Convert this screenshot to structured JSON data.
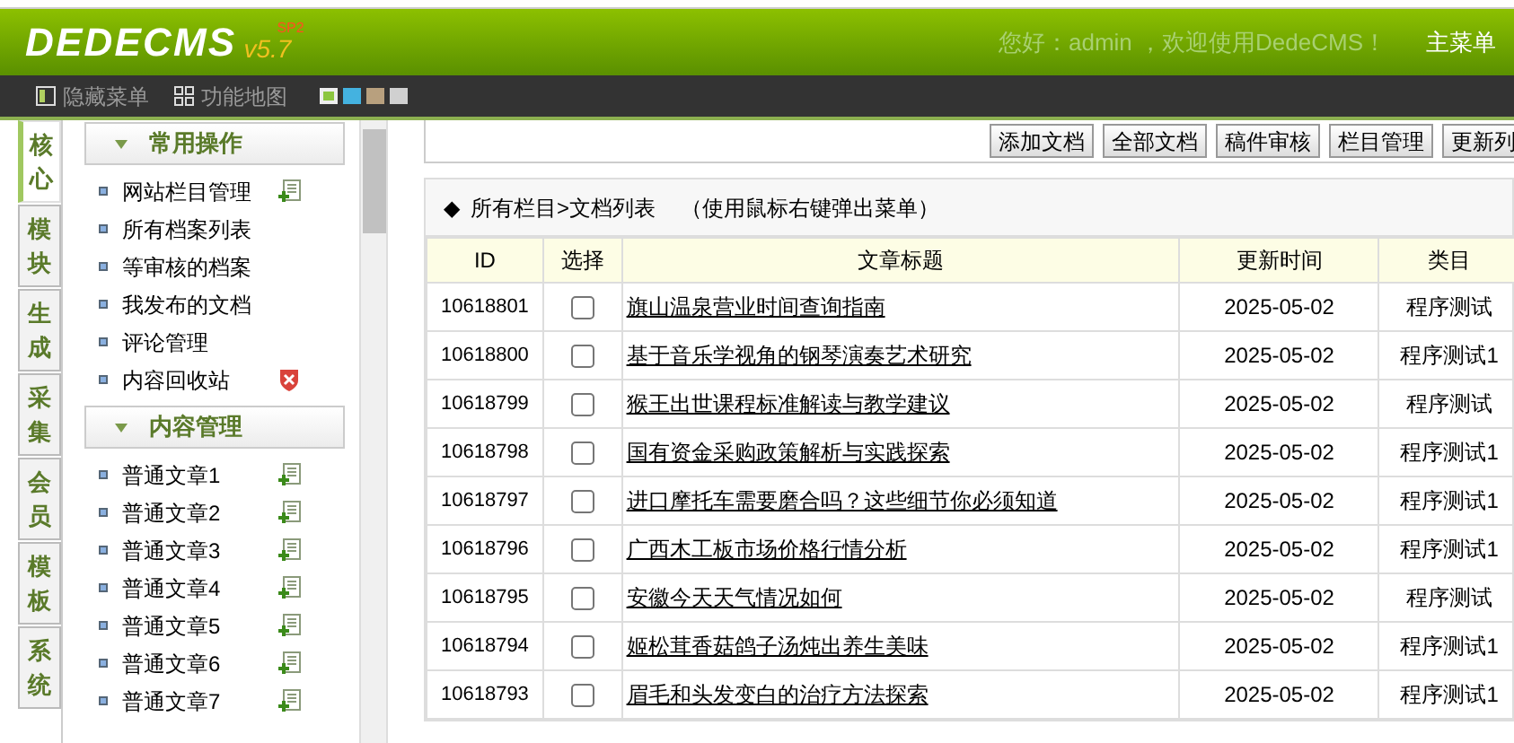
{
  "header": {
    "logo": "DEDECMS",
    "version": "v5.7",
    "edition": "SP2",
    "welcome": "您好：admin ，欢迎使用DedeCMS！",
    "main_menu": "主菜单"
  },
  "toolbar": {
    "items": [
      {
        "label": "隐藏菜单",
        "kind": "layout"
      },
      {
        "label": "功能地图",
        "kind": "grid"
      }
    ],
    "skins": [
      {
        "color": "#8cc63f",
        "selected": true
      },
      {
        "color": "#44b2e0",
        "selected": false
      },
      {
        "color": "#b8a07e",
        "selected": false
      },
      {
        "color": "#d0d0d0",
        "selected": false
      }
    ]
  },
  "side_tabs": [
    {
      "label": "核心",
      "selected": true
    },
    {
      "label": "模块",
      "selected": false
    },
    {
      "label": "生成",
      "selected": false
    },
    {
      "label": "采集",
      "selected": false
    },
    {
      "label": "会员",
      "selected": false
    },
    {
      "label": "模板",
      "selected": false
    },
    {
      "label": "系统",
      "selected": false
    }
  ],
  "menu_groups": [
    {
      "title": "常用操作",
      "items": [
        {
          "label": "网站栏目管理",
          "kind": "add"
        },
        {
          "label": "所有档案列表",
          "kind": "plain"
        },
        {
          "label": "等审核的档案",
          "kind": "plain"
        },
        {
          "label": "我发布的文档",
          "kind": "plain"
        },
        {
          "label": "评论管理",
          "kind": "plain"
        },
        {
          "label": "内容回收站",
          "kind": "delete"
        }
      ]
    },
    {
      "title": "内容管理",
      "items": [
        {
          "label": "普通文章1",
          "kind": "add"
        },
        {
          "label": "普通文章2",
          "kind": "add"
        },
        {
          "label": "普通文章3",
          "kind": "add"
        },
        {
          "label": "普通文章4",
          "kind": "add"
        },
        {
          "label": "普通文章5",
          "kind": "add"
        },
        {
          "label": "普通文章6",
          "kind": "add"
        },
        {
          "label": "普通文章7",
          "kind": "add"
        }
      ]
    }
  ],
  "actions": [
    "添加文档",
    "全部文档",
    "稿件审核",
    "栏目管理",
    "更新列"
  ],
  "breadcrumb": {
    "bullet": "◆",
    "path": "所有栏目>文档列表",
    "hint": "（使用鼠标右键弹出菜单）"
  },
  "table": {
    "columns": [
      "ID",
      "选择",
      "文章标题",
      "更新时间",
      "类目"
    ],
    "rows": [
      {
        "id": "10618801",
        "checked": false,
        "title": "旗山温泉营业时间查询指南",
        "date": "2025-05-02",
        "category": "程序测试"
      },
      {
        "id": "10618800",
        "checked": false,
        "title": "基于音乐学视角的钢琴演奏艺术研究",
        "date": "2025-05-02",
        "category": "程序测试1"
      },
      {
        "id": "10618799",
        "checked": false,
        "title": "猴王出世课程标准解读与教学建议",
        "date": "2025-05-02",
        "category": "程序测试"
      },
      {
        "id": "10618798",
        "checked": false,
        "title": "国有资金采购政策解析与实践探索",
        "date": "2025-05-02",
        "category": "程序测试1"
      },
      {
        "id": "10618797",
        "checked": false,
        "title": "进口摩托车需要磨合吗？这些细节你必须知道",
        "date": "2025-05-02",
        "category": "程序测试1"
      },
      {
        "id": "10618796",
        "checked": false,
        "title": "广西木工板市场价格行情分析",
        "date": "2025-05-02",
        "category": "程序测试1"
      },
      {
        "id": "10618795",
        "checked": false,
        "title": "安徽今天天气情况如何",
        "date": "2025-05-02",
        "category": "程序测试"
      },
      {
        "id": "10618794",
        "checked": false,
        "title": "姬松茸香菇鸽子汤炖出养生美味",
        "date": "2025-05-02",
        "category": "程序测试1"
      },
      {
        "id": "10618793",
        "checked": false,
        "title": "眉毛和头发变白的治疗方法探索",
        "date": "2025-05-02",
        "category": "程序测试1"
      }
    ]
  }
}
